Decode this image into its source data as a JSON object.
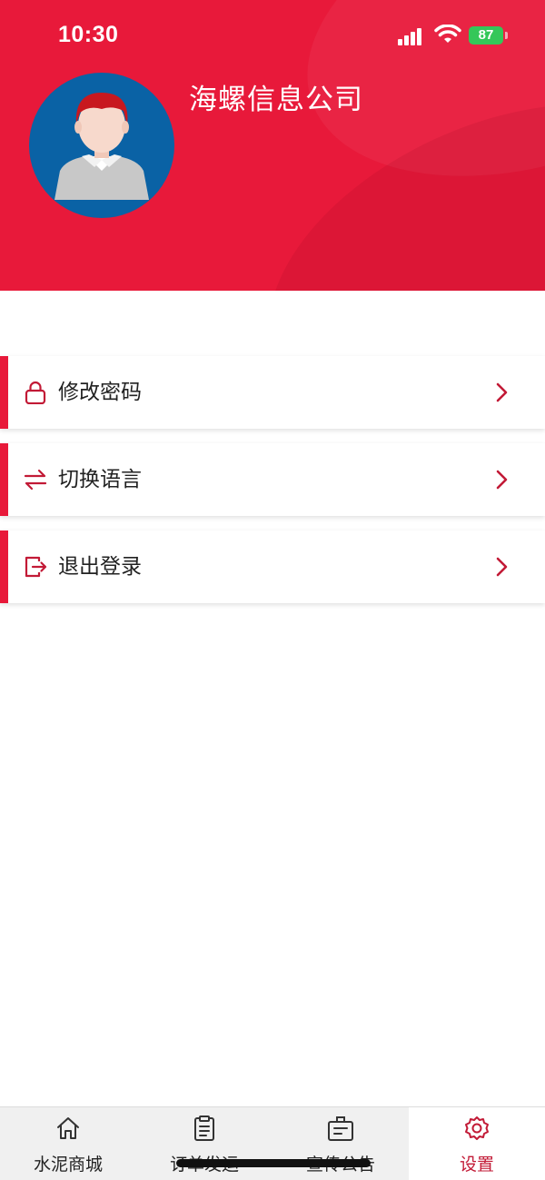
{
  "status_bar": {
    "time": "10:30",
    "battery": "87"
  },
  "header": {
    "company_name": "海螺信息公司"
  },
  "menu": [
    {
      "label": "修改密码",
      "icon": "lock-icon"
    },
    {
      "label": "切换语言",
      "icon": "swap-icon"
    },
    {
      "label": "退出登录",
      "icon": "logout-icon"
    }
  ],
  "tabs": [
    {
      "label": "水泥商城",
      "icon": "home-icon"
    },
    {
      "label": "订单发运",
      "icon": "clipboard-icon"
    },
    {
      "label": "宣传公告",
      "icon": "notice-board-icon"
    },
    {
      "label": "设置",
      "icon": "gear-icon",
      "active": true
    }
  ],
  "colors": {
    "brand": "#e8193a",
    "accent": "#c21a36",
    "battery": "#34c759",
    "avatar_bg": "#0a62a5"
  }
}
